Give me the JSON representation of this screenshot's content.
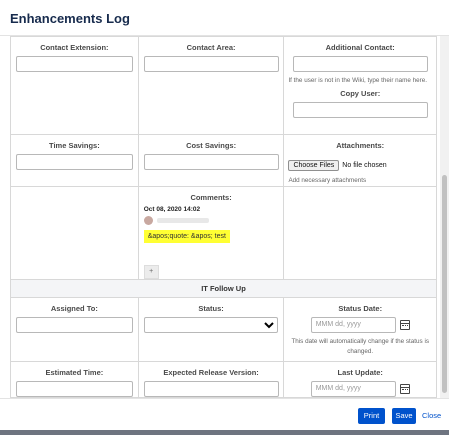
{
  "dialog": {
    "title": "Enhancements Log"
  },
  "row1": {
    "contact_extension": "Contact Extension:",
    "contact_area": "Contact Area:",
    "additional_contact": "Additional Contact:",
    "wiki_hint": "If the user is not in the Wiki, type their name here.",
    "copy_user": "Copy User:"
  },
  "row2": {
    "time_savings": "Time Savings:",
    "cost_savings": "Cost Savings:",
    "attachments": "Attachments:",
    "choose_files": "Choose Files",
    "no_file": "No file chosen",
    "attach_hint": "Add necessary attachments"
  },
  "comments": {
    "label": "Comments:",
    "timestamp": "Oct 08, 2020 14:02",
    "text": "&apos;quote: &apos; test",
    "add": "+"
  },
  "it_follow_up": {
    "section_title": "IT Follow Up",
    "assigned_to": "Assigned To:",
    "status": "Status:",
    "status_date": "Status Date:",
    "date_placeholder": "MMM dd, yyyy",
    "status_hint": "This date will automatically change if the status is changed.",
    "estimated_time": "Estimated Time:",
    "expected_release": "Expected Release Version:",
    "last_update": "Last Update:"
  },
  "footer": {
    "print": "Print",
    "save": "Save",
    "close": "Close"
  },
  "colors": {
    "primary": "#0052cc",
    "highlight": "#ffff33"
  }
}
